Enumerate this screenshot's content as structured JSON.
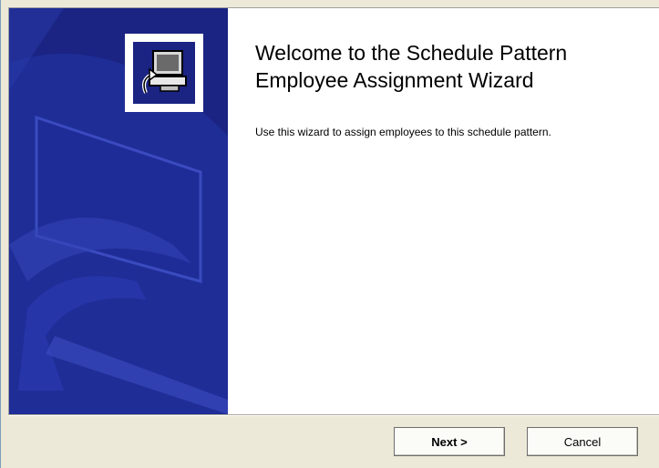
{
  "wizard": {
    "title": "Welcome to the Schedule Pattern Employee Assignment Wizard",
    "description": "Use this wizard to assign employees to this schedule pattern.",
    "sidebar_icon": "computer-arrow-icon"
  },
  "buttons": {
    "next_label": "Next >",
    "cancel_label": "Cancel"
  },
  "colors": {
    "sidebar": "#1f2a8f",
    "panel": "#ffffff",
    "dialog_bg": "#ece9d8"
  }
}
